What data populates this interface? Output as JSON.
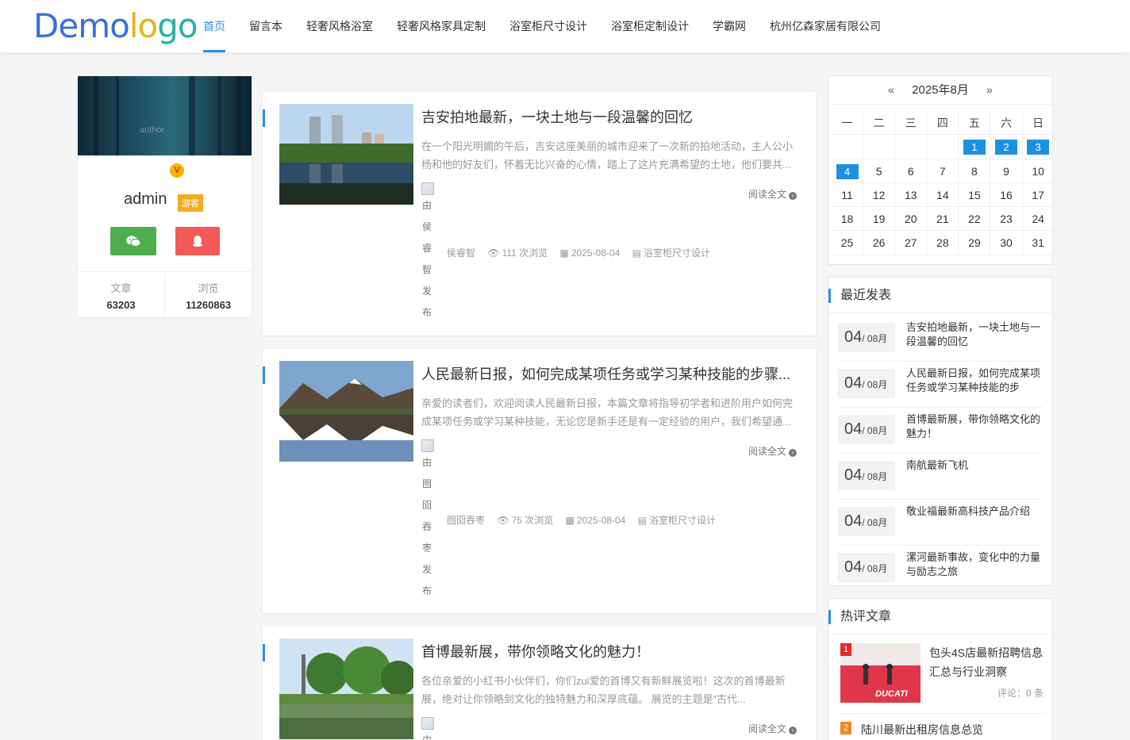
{
  "header": {
    "logo_letters": [
      "D",
      "e",
      "m",
      "o",
      "l",
      "o",
      "g",
      "o"
    ],
    "logo_colors": [
      "#3a6fd8",
      "#3a6fd8",
      "#3a6fd8",
      "#3a6fd8",
      "#e8b31c",
      "#e8b31c",
      "#27b0a2",
      "#27b0a2"
    ],
    "nav": [
      {
        "label": "首页",
        "active": true
      },
      {
        "label": "留言本"
      },
      {
        "label": "轻奢风格浴室"
      },
      {
        "label": "轻奢风格家具定制"
      },
      {
        "label": "浴室柜尺寸设计"
      },
      {
        "label": "浴室柜定制设计"
      },
      {
        "label": "学霸网"
      },
      {
        "label": "杭州亿森家居有限公司"
      }
    ]
  },
  "profile": {
    "banner_text": "author",
    "badge": "V",
    "name": "admin",
    "tag": "游客",
    "stats": [
      {
        "label": "文章",
        "value": "63203"
      },
      {
        "label": "浏览",
        "value": "11260863"
      }
    ]
  },
  "posts": [
    {
      "title": "吉安拍地最新，一块土地与一段温馨的回忆",
      "excerpt": "在一个阳光明媚的午后，吉安这座美丽的城市迎来了一次新的拍地活动，主人公小杨和他的好友们，怀着无比兴奋的心情，踏上了这片充满希望的土地，他们要共...",
      "alt_chars": [
        "由",
        "侯",
        "睿",
        "智",
        "发",
        "布"
      ],
      "author": "侯睿智",
      "views": "111 次浏览",
      "date": "2025-08-04",
      "category": "浴室柜尺寸设计",
      "readmore": "阅读全文"
    },
    {
      "title": "人民最新日报，如何完成某项任务或学习某种技能的步骤...",
      "excerpt": "亲爱的读者们，欢迎阅读人民最新日报，本篇文章将指导初学者和进阶用户如何完成某项任务或学习某种技能，无论您是新手还是有一定经验的用户，我们希望通...",
      "alt_chars": [
        "由",
        "囫",
        "囵",
        "吞",
        "枣",
        "发",
        "布"
      ],
      "author": "囫囵吞枣",
      "views": "75 次浏览",
      "date": "2025-08-04",
      "category": "浴室柜尺寸设计",
      "readmore": "阅读全文"
    },
    {
      "title": "首博最新展，带你领略文化的魅力！",
      "excerpt": "各位亲爱的小红书小伙伴们，你们zui爱的首博又有新鲜展览啦！这次的首博最新展，绝对让你领略到文化的独特魅力和深厚底蕴。 展览的主题是“古代...",
      "alt_chars": [
        "由"
      ],
      "readmore": "阅读全文"
    }
  ],
  "calendar": {
    "month": "2025年8月",
    "prev": "«",
    "next": "»",
    "weekdays": [
      "一",
      "二",
      "三",
      "四",
      "五",
      "六",
      "日"
    ],
    "cells": [
      "",
      "",
      "",
      "",
      "1",
      "2",
      "3",
      "4",
      "5",
      "6",
      "7",
      "8",
      "9",
      "10",
      "11",
      "12",
      "13",
      "14",
      "15",
      "16",
      "17",
      "18",
      "19",
      "20",
      "21",
      "22",
      "23",
      "24",
      "25",
      "26",
      "27",
      "28",
      "29",
      "30",
      "31"
    ],
    "highlighted": [
      "1",
      "2",
      "3",
      "4"
    ]
  },
  "recent": {
    "title": "最近发表",
    "items": [
      {
        "day": "04",
        "month": "/ 08月",
        "text": "吉安拍地最新，一块土地与一段温馨的回忆"
      },
      {
        "day": "04",
        "month": "/ 08月",
        "text": "人民最新日报，如何完成某项任务或学习某种技能的步"
      },
      {
        "day": "04",
        "month": "/ 08月",
        "text": "首博最新展，带你领略文化的魅力！"
      },
      {
        "day": "04",
        "month": "/ 08月",
        "text": "南航最新飞机"
      },
      {
        "day": "04",
        "month": "/ 08月",
        "text": "敬业福最新高科技产品介绍"
      },
      {
        "day": "04",
        "month": "/ 08月",
        "text": "漯河最新事故，变化中的力量与励志之旅"
      }
    ]
  },
  "hot": {
    "title": "热评文章",
    "items": [
      {
        "rank": "1",
        "text": "包头4S店最新招聘信息汇总与行业洞察",
        "comments": "评论：0 条",
        "thumb_text": "DUCATI",
        "rank_color": "#e02a2a"
      },
      {
        "rank": "2",
        "text": "陆川最新出租房信息总览",
        "rank_color": "#f08a24"
      }
    ]
  }
}
